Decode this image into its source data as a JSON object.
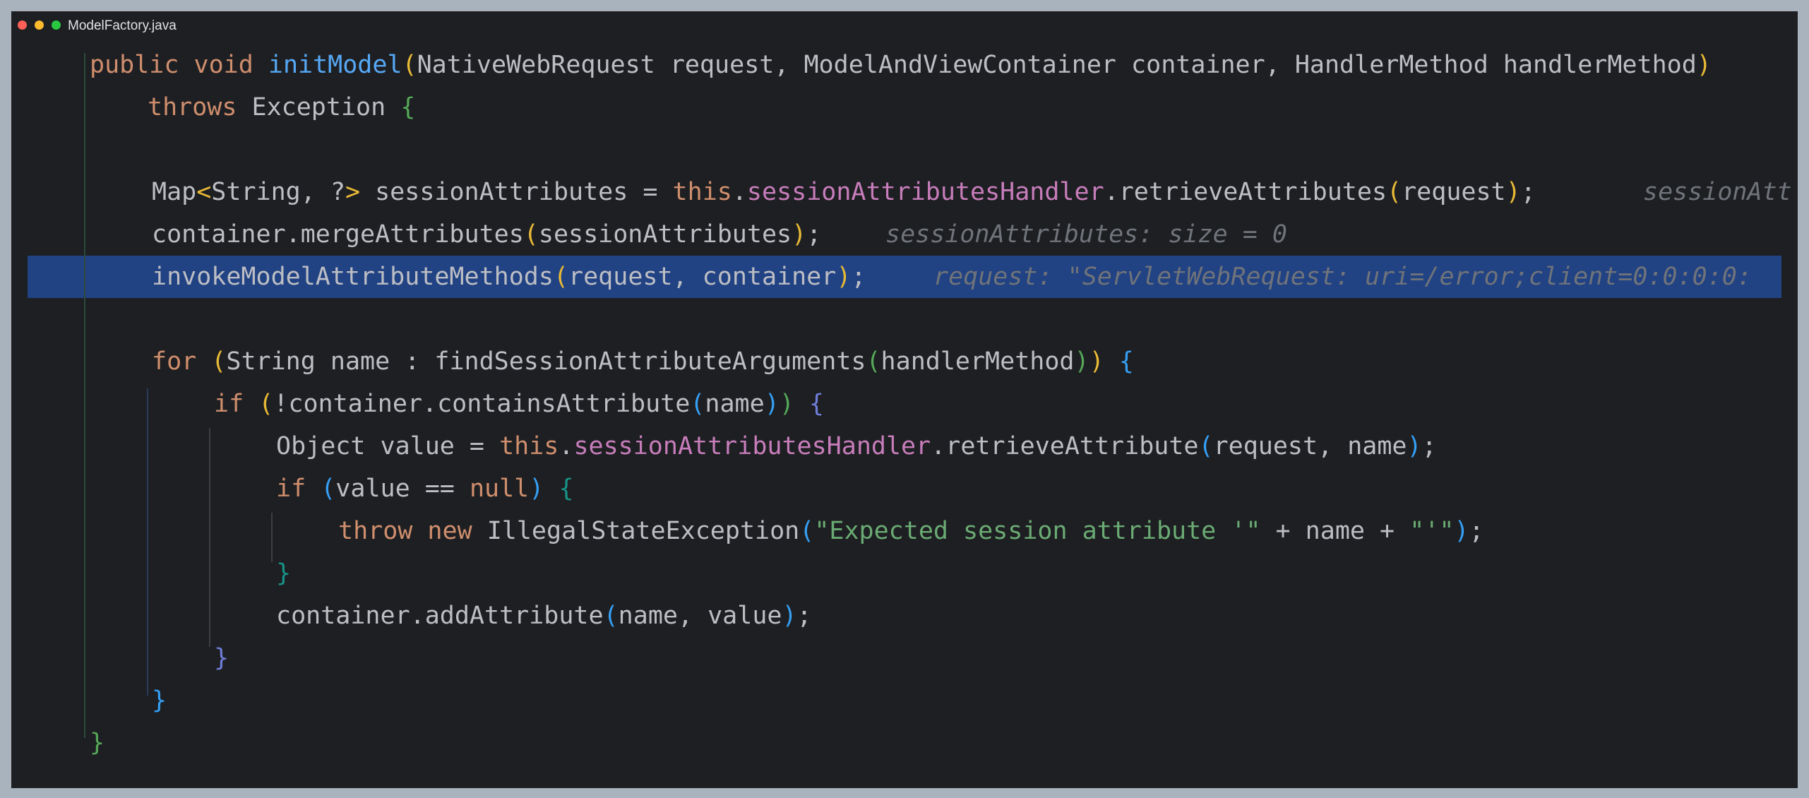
{
  "window": {
    "title": "ModelFactory.java"
  },
  "code": {
    "l1": {
      "a": "public void ",
      "b": "initModel",
      "c": "(",
      "d": "NativeWebRequest request, ModelAndViewContainer container, HandlerMethod handlerMethod",
      "e": ")"
    },
    "l2": {
      "a": "throws ",
      "b": "Exception ",
      "c": "{"
    },
    "l3": {
      "a": "Map",
      "b": "<",
      "c": "String, ?",
      "d": ">",
      "e": " sessionAttributes = ",
      "f": "this",
      "g": ".",
      "h": "sessionAttributesHandler",
      "i": ".retrieveAttributes",
      "j": "(",
      "k": "request",
      "l": ")",
      "m": ";",
      "hint": "sessionAtt"
    },
    "l4": {
      "a": "container.mergeAttributes",
      "b": "(",
      "c": "sessionAttributes",
      "d": ")",
      "e": ";",
      "hint": "sessionAttributes: size = 0"
    },
    "l5": {
      "a": "invokeModelAttributeMethods",
      "b": "(",
      "c": "request, container",
      "d": ")",
      "e": ";",
      "hint": "request: \"ServletWebRequest: uri=/error;client=0:0:0:0:"
    },
    "l6": {
      "a": "for ",
      "b": "(",
      "c": "String name : findSessionAttributeArguments",
      "d": "(",
      "e": "handlerMethod",
      "f": ")",
      "g": ")",
      "h": " {"
    },
    "l7": {
      "a": "if ",
      "b": "(",
      "c": "!container.containsAttribute",
      "d": "(",
      "e": "name",
      "f": ")",
      "g": ")",
      "h": " {"
    },
    "l8": {
      "a": "Object value = ",
      "b": "this",
      "c": ".",
      "d": "sessionAttributesHandler",
      "e": ".retrieveAttribute",
      "f": "(",
      "g": "request, name",
      "h": ")",
      "i": ";"
    },
    "l9": {
      "a": "if ",
      "b": "(",
      "c": "value ",
      "d": "==",
      "e": " ",
      "f": "null",
      "g": ")",
      "h": " {"
    },
    "l10": {
      "a": "throw new ",
      "b": "IllegalStateException",
      "c": "(",
      "d": "\"Expected session attribute '\"",
      "e": " + name + ",
      "f": "\"'\"",
      "g": ")",
      "h": ";"
    },
    "l11": {
      "a": "}"
    },
    "l12": {
      "a": "container.addAttribute",
      "b": "(",
      "c": "name, value",
      "d": ")",
      "e": ";"
    },
    "l13": {
      "a": "}"
    },
    "l14": {
      "a": "}"
    },
    "l15": {
      "a": "}"
    }
  },
  "colors": {
    "background": "#1e1f22",
    "keyword": "#cf8e6d",
    "method_declaration": "#56a8f5",
    "field": "#c77dbb",
    "string": "#6aab73",
    "inlay_hint": "#6f737a",
    "execution_line": "#214283",
    "frame": "#a9b3bd"
  }
}
